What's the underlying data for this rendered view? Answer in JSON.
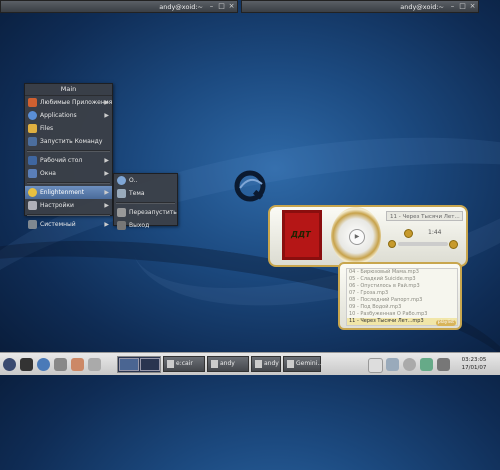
{
  "top_windows": [
    {
      "title": "andy@xoid:~"
    },
    {
      "title": "andy@xoid:~"
    }
  ],
  "main_menu": {
    "title": "Main",
    "items": [
      {
        "label": "Любимые Приложения",
        "icon": "favorites-icon",
        "submenu": true
      },
      {
        "label": "Applications",
        "icon": "applications-icon",
        "submenu": true
      },
      {
        "label": "Files",
        "icon": "files-icon",
        "submenu": false
      },
      {
        "label": "Запустить Команду",
        "icon": "run-command-icon",
        "submenu": false
      },
      {
        "label": "Рабочий стол",
        "icon": "desktop-icon",
        "submenu": true
      },
      {
        "label": "Окна",
        "icon": "windows-icon",
        "submenu": true
      },
      {
        "label": "Enlightenment",
        "icon": "enlightenment-icon",
        "submenu": true,
        "selected": true
      },
      {
        "label": "Настройки",
        "icon": "settings-icon",
        "submenu": true
      },
      {
        "label": "Системный",
        "icon": "system-icon",
        "submenu": true
      }
    ]
  },
  "sub_menu": {
    "items": [
      {
        "label": "О..",
        "icon": "about-icon"
      },
      {
        "label": "Тема",
        "icon": "theme-icon"
      },
      {
        "label": "Перезапустить",
        "icon": "restart-icon"
      },
      {
        "label": "Выход",
        "icon": "exit-icon"
      }
    ]
  },
  "player": {
    "cover_text": "ДДТ",
    "now_playing": "11 - Через Тысячи Лет...",
    "time": "1:44",
    "play_symbol": "▶"
  },
  "playlist": {
    "tracks": [
      "04 - Бирюзовый Мама.mp3",
      "05 - Сладкий Suicide.mp3",
      "06 - Опустилось в Рай.mp3",
      "07 - Гроза.mp3",
      "08 - Последний Рапорт.mp3",
      "09 - Под Водой.mp3",
      "10 - Разбуженная О Рабо.mp3",
      "11 - Через Тысячи Лет...mp3"
    ],
    "current_index": 7,
    "button": "playlist"
  },
  "taskbar": {
    "tasks": [
      {
        "label": "e:cair"
      },
      {
        "label": "andy"
      },
      {
        "label": "andy"
      },
      {
        "label": "Gemini..."
      }
    ],
    "clock_time": "03:23:05",
    "clock_date": "17/01/07"
  },
  "colors": {
    "menu_bg": "#3c4046",
    "selected": "#5b7fb0",
    "player_gold": "#c8a64e",
    "cover_red": "#b51616"
  }
}
